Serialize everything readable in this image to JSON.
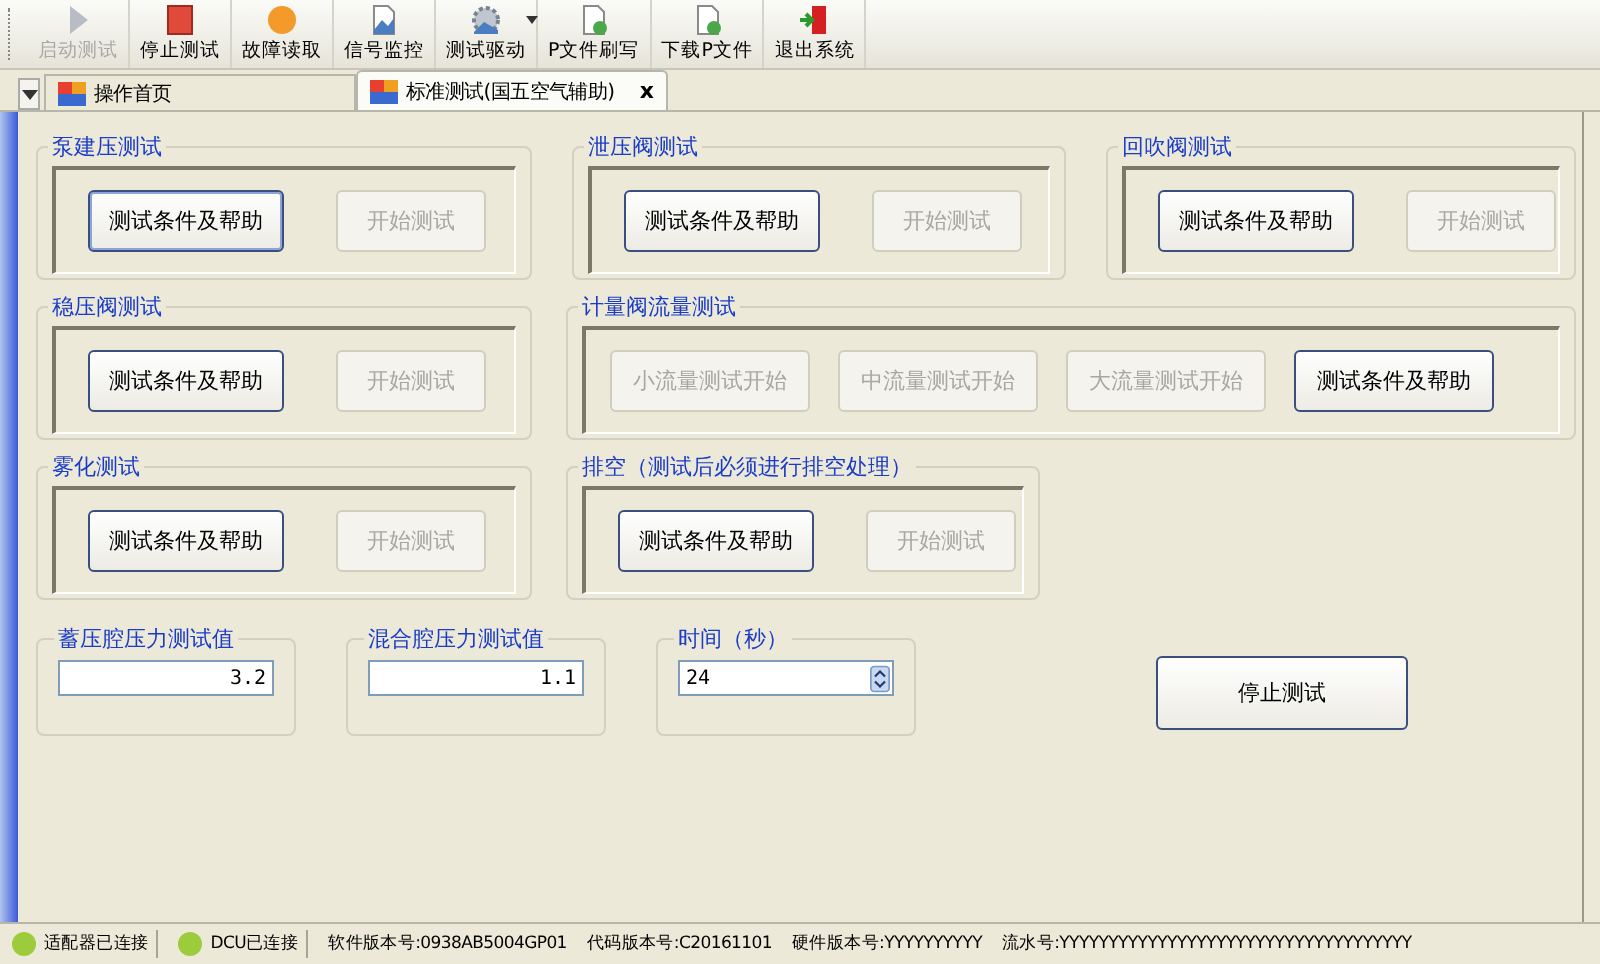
{
  "toolbar": [
    {
      "label": "启动测试",
      "kind": "play",
      "disabled": true,
      "dropdown": false
    },
    {
      "label": "停止测试",
      "kind": "stop",
      "disabled": false,
      "dropdown": false
    },
    {
      "label": "故障读取",
      "kind": "circle",
      "disabled": false,
      "dropdown": false
    },
    {
      "label": "信号监控",
      "kind": "chart-doc",
      "disabled": false,
      "dropdown": false
    },
    {
      "label": "测试驱动",
      "kind": "gear",
      "disabled": false,
      "dropdown": true
    },
    {
      "label": "P文件刷写",
      "kind": "doc",
      "disabled": false,
      "dropdown": false
    },
    {
      "label": "下载P文件",
      "kind": "doc",
      "disabled": false,
      "dropdown": false
    },
    {
      "label": "退出系统",
      "kind": "exit",
      "disabled": false,
      "dropdown": false
    }
  ],
  "tabs": [
    {
      "label": "操作首页",
      "selected": false
    },
    {
      "label": "标准测试(国五空气辅助)",
      "selected": true,
      "close": "x"
    }
  ],
  "rows": [
    {
      "sections": [
        {
          "title": "泵建压测试",
          "buttons": [
            {
              "label": "测试条件及帮助",
              "disabled": false,
              "focused": true
            },
            {
              "label": "开始测试",
              "disabled": true,
              "focused": false
            }
          ]
        },
        {
          "title": "泄压阀测试",
          "buttons": [
            {
              "label": "测试条件及帮助",
              "disabled": false,
              "focused": false
            },
            {
              "label": "开始测试",
              "disabled": true,
              "focused": false
            }
          ]
        },
        {
          "title": "回吹阀测试",
          "buttons": [
            {
              "label": "测试条件及帮助",
              "disabled": false,
              "focused": false
            },
            {
              "label": "开始测试",
              "disabled": true,
              "focused": false
            }
          ]
        }
      ]
    },
    {
      "sections": [
        {
          "title": "稳压阀测试",
          "buttons": [
            {
              "label": "测试条件及帮助",
              "disabled": false,
              "focused": false
            },
            {
              "label": "开始测试",
              "disabled": true,
              "focused": false
            }
          ]
        },
        {
          "title": "计量阀流量测试",
          "buttons": [
            {
              "label": "小流量测试开始",
              "disabled": true,
              "focused": false
            },
            {
              "label": "中流量测试开始",
              "disabled": true,
              "focused": false
            },
            {
              "label": "大流量测试开始",
              "disabled": true,
              "focused": false
            },
            {
              "label": "测试条件及帮助",
              "disabled": false,
              "focused": false
            }
          ]
        }
      ]
    },
    {
      "sections": [
        {
          "title": "雾化测试",
          "buttons": [
            {
              "label": "测试条件及帮助",
              "disabled": false,
              "focused": false
            },
            {
              "label": "开始测试",
              "disabled": true,
              "focused": false
            }
          ]
        },
        {
          "title": "排空（测试后必须进行排空处理）",
          "buttons": [
            {
              "label": "测试条件及帮助",
              "disabled": false,
              "focused": false
            },
            {
              "label": "开始测试",
              "disabled": true,
              "focused": false
            }
          ]
        }
      ]
    }
  ],
  "values": [
    {
      "label": "蓄压腔压力测试值",
      "value": "3.2",
      "kind": "text"
    },
    {
      "label": "混合腔压力测试值",
      "value": "1.1",
      "kind": "text"
    },
    {
      "label": "时间（秒）",
      "value": "24",
      "kind": "spin"
    }
  ],
  "stop_button": {
    "label": "停止测试"
  },
  "status_bar": [
    {
      "kind": "led",
      "text": "适配器已连接",
      "color": "#9ccc3c"
    },
    {
      "kind": "led",
      "text": "DCU已连接",
      "color": "#9ccc3c"
    },
    {
      "kind": "text",
      "text": "软件版本号:0938AB5004GP01"
    },
    {
      "kind": "text",
      "text": "代码版本号:C20161101"
    },
    {
      "kind": "text",
      "text": "硬件版本号:YYYYYYYYYY"
    },
    {
      "kind": "text",
      "text": "流水号:YYYYYYYYYYYYYYYYYYYYYYYYYYYYYYYYYYYY"
    }
  ]
}
